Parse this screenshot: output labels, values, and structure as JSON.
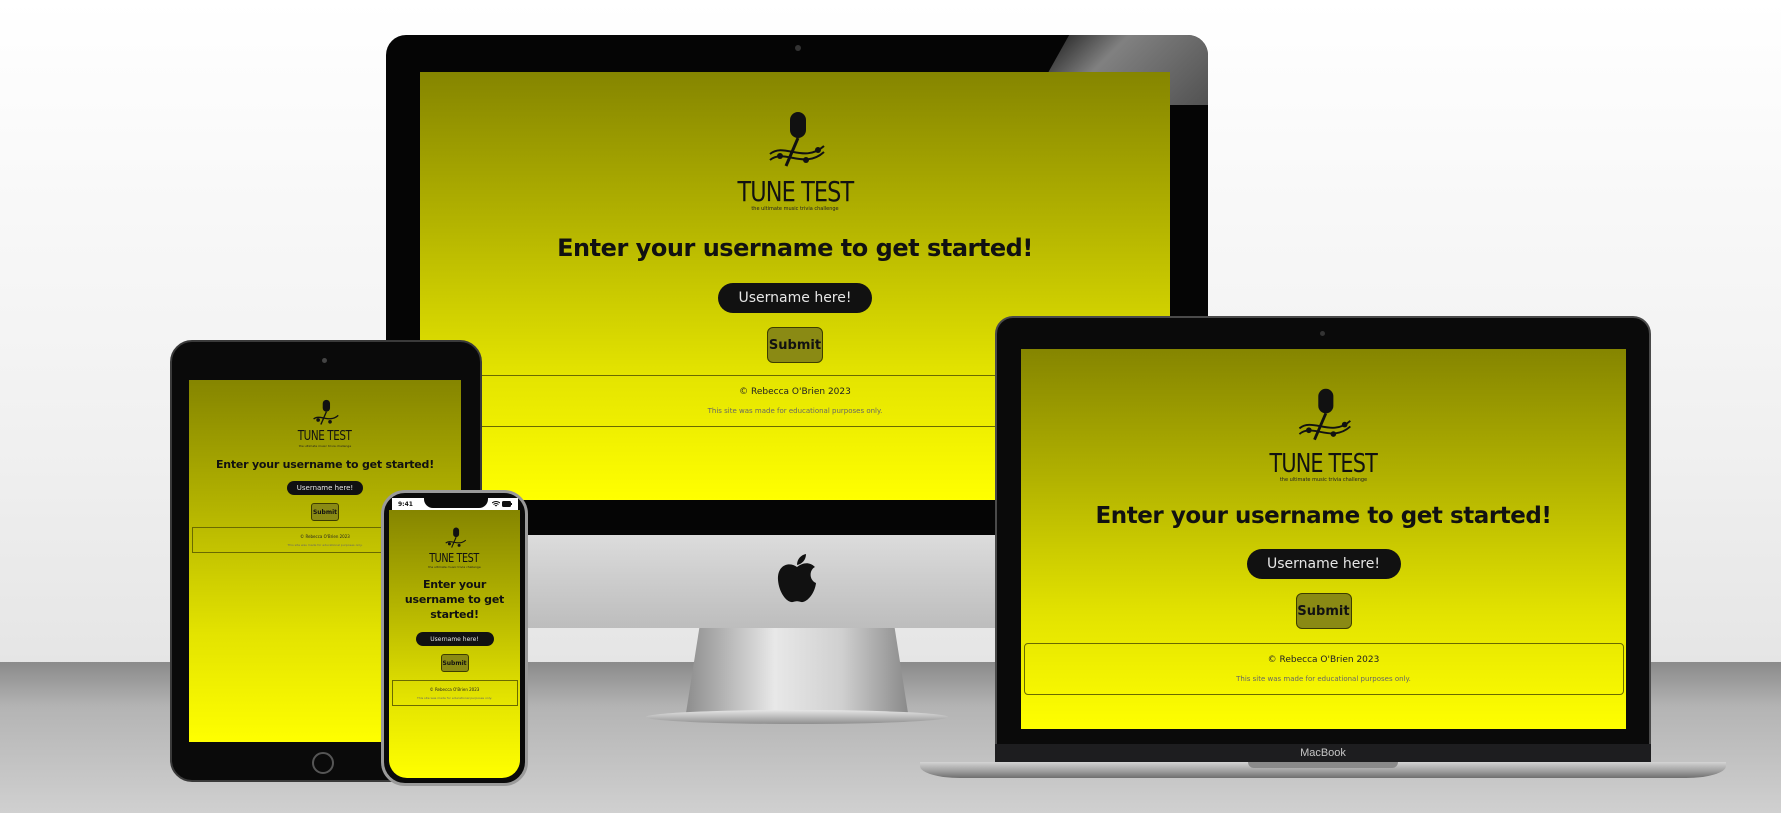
{
  "app": {
    "title": "TUNE TEST",
    "tagline": "the ultimate music trivia challenge",
    "heading": "Enter your username to get started!",
    "input_placeholder": "Username here!",
    "submit_label": "Submit",
    "copyright": "© Rebecca O'Brien 2023",
    "disclaimer": "This site was made for educational purposes only."
  },
  "devices": {
    "laptop_label": "MacBook",
    "phone_time": "9:41"
  },
  "colors": {
    "gradient_top": "#858500",
    "gradient_bottom": "#ffff00",
    "input_bg": "#111111",
    "submit_bg": "#8a8a14"
  },
  "icons": [
    "microphone-icon",
    "music-notes-icon",
    "apple-logo-icon",
    "wifi-icon",
    "battery-icon"
  ]
}
